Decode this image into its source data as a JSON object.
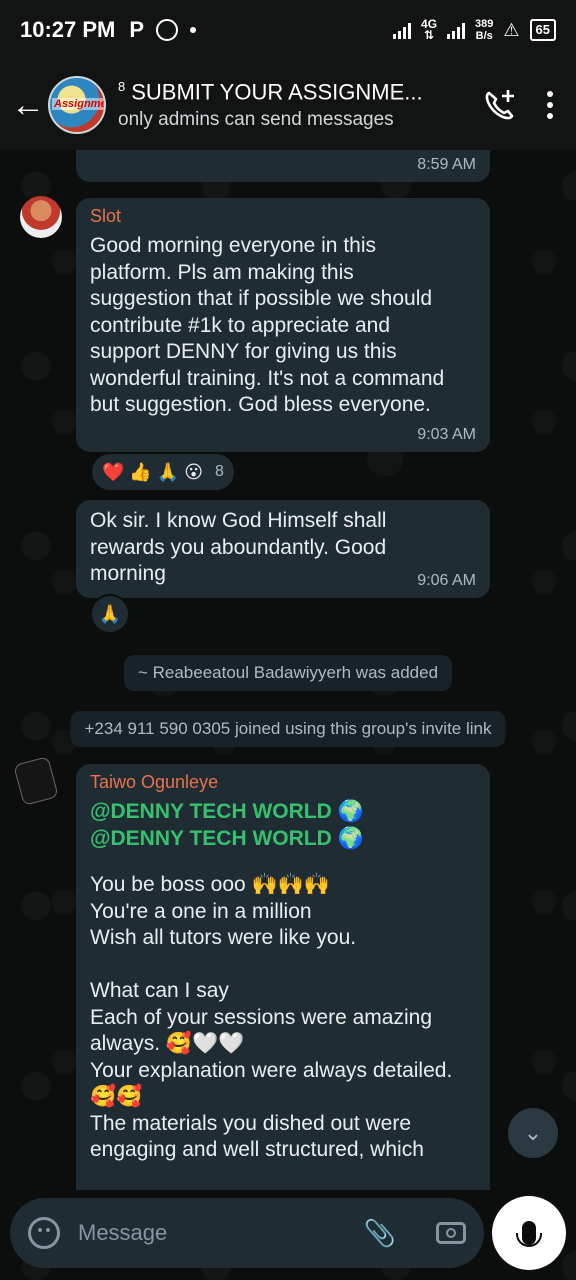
{
  "status_bar": {
    "time": "10:27 PM",
    "app_badge": "P",
    "net_type": "4G",
    "speed_value": "389",
    "speed_unit": "B/s",
    "battery": "65"
  },
  "header": {
    "avatar_text": "Assignment",
    "mention_count": "8",
    "group_name": "SUBMIT YOUR ASSIGNME...",
    "subtitle": "only admins can send messages"
  },
  "messages": {
    "previous_time": "8:59 AM",
    "slot": {
      "sender": "Slot",
      "text": "Good morning everyone in this\nplatform. Pls am making this\nsuggestion that if possible we should\ncontribute #1k to appreciate and\nsupport DENNY for giving us this\nwonderful training. It's not a command\nbut suggestion. God bless everyone.",
      "time": "9:03 AM",
      "reactions": "❤️ 👍 🙏 😮",
      "reaction_count": "8"
    },
    "reply": {
      "text": "Ok sir. I know God Himself shall\nrewards you aboundantly. Good\nmorning",
      "time": "9:06 AM",
      "reaction": "🙏"
    },
    "system1": "~ Reabeeatoul Badawiyyerh was added",
    "system2": "+234 911 590 0305 joined using this group's invite link",
    "taiwo": {
      "sender": "Taiwo Ogunleye",
      "mention1": "@DENNY TECH WORLD 🌍",
      "mention2": "@DENNY TECH WORLD 🌍",
      "text": "You be boss ooo 🙌🙌🙌\nYou're a one in a million\nWish all tutors were like you.\n\nWhat can I say\nEach of your sessions were amazing\nalways. 🥰🤍🤍\nYour explanation were always detailed.\n🥰🥰\nThe materials you dished out were\nengaging and well structured, which"
    }
  },
  "input": {
    "placeholder": "Message"
  },
  "colors": {
    "bubble": "#202c33",
    "sender": "#e8734b",
    "mention": "#34c26e",
    "background": "#0b0d0c"
  }
}
